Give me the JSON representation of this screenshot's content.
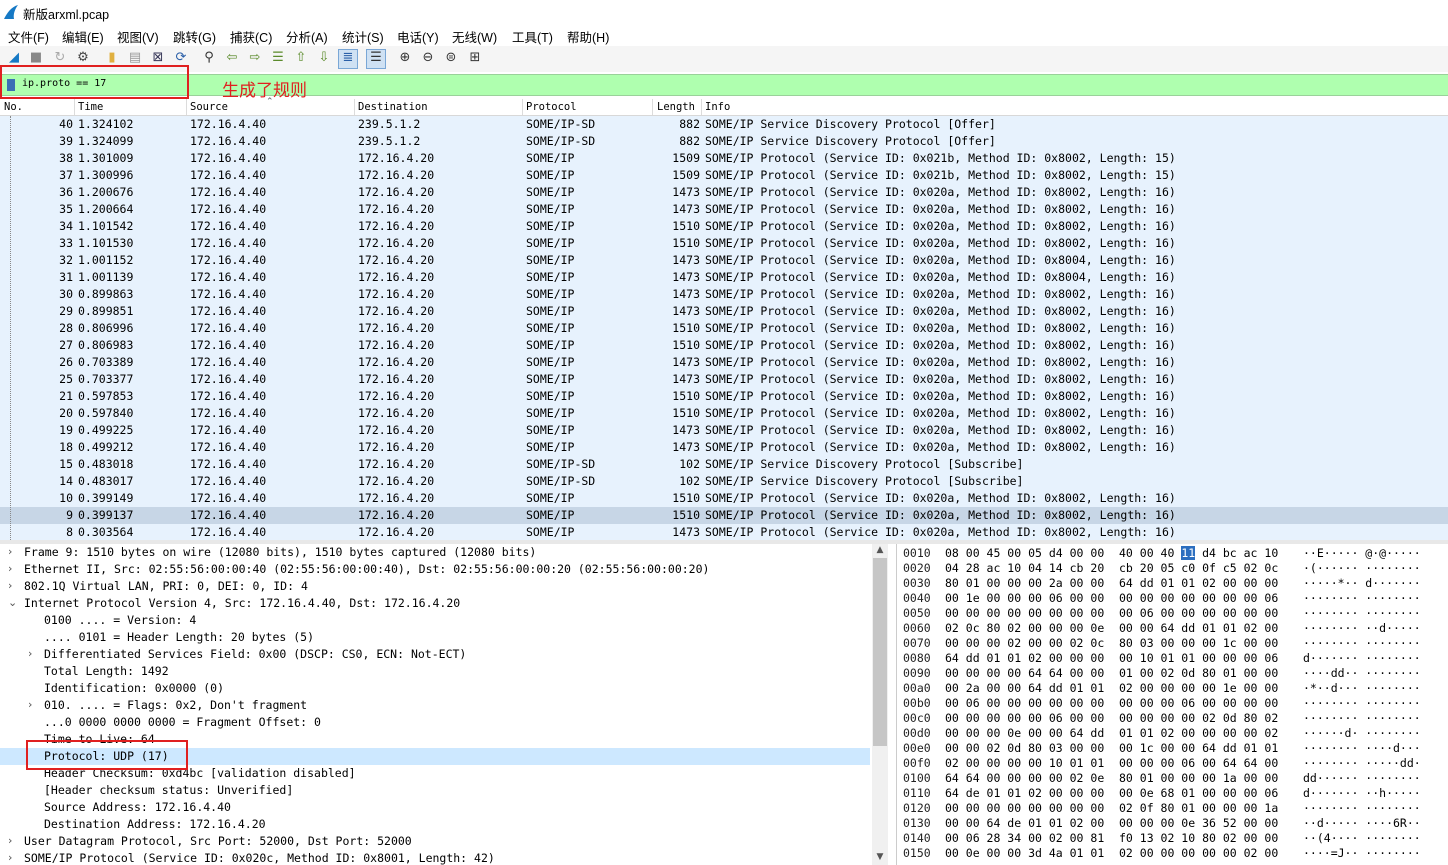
{
  "window": {
    "title": "新版arxml.pcap"
  },
  "menu": [
    "文件(F)",
    "编辑(E)",
    "视图(V)",
    "跳转(G)",
    "捕获(C)",
    "分析(A)",
    "统计(S)",
    "电话(Y)",
    "无线(W)",
    "工具(T)",
    "帮助(H)"
  ],
  "filter": {
    "value": "ip.proto == 17"
  },
  "annotation": "生成了规则",
  "columns": [
    "No.",
    "Time",
    "Source",
    "Destination",
    "Protocol",
    "Length",
    "Info"
  ],
  "packets": [
    {
      "no": "40",
      "time": "1.324102",
      "src": "172.16.4.40",
      "dst": "239.5.1.2",
      "proto": "SOME/IP-SD",
      "len": "882",
      "info": "SOME/IP Service Discovery Protocol [Offer]"
    },
    {
      "no": "39",
      "time": "1.324099",
      "src": "172.16.4.40",
      "dst": "239.5.1.2",
      "proto": "SOME/IP-SD",
      "len": "882",
      "info": "SOME/IP Service Discovery Protocol [Offer]"
    },
    {
      "no": "38",
      "time": "1.301009",
      "src": "172.16.4.40",
      "dst": "172.16.4.20",
      "proto": "SOME/IP",
      "len": "1509",
      "info": "SOME/IP Protocol (Service ID: 0x021b, Method ID: 0x8002, Length: 15)"
    },
    {
      "no": "37",
      "time": "1.300996",
      "src": "172.16.4.40",
      "dst": "172.16.4.20",
      "proto": "SOME/IP",
      "len": "1509",
      "info": "SOME/IP Protocol (Service ID: 0x021b, Method ID: 0x8002, Length: 15)"
    },
    {
      "no": "36",
      "time": "1.200676",
      "src": "172.16.4.40",
      "dst": "172.16.4.20",
      "proto": "SOME/IP",
      "len": "1473",
      "info": "SOME/IP Protocol (Service ID: 0x020a, Method ID: 0x8002, Length: 16)"
    },
    {
      "no": "35",
      "time": "1.200664",
      "src": "172.16.4.40",
      "dst": "172.16.4.20",
      "proto": "SOME/IP",
      "len": "1473",
      "info": "SOME/IP Protocol (Service ID: 0x020a, Method ID: 0x8002, Length: 16)"
    },
    {
      "no": "34",
      "time": "1.101542",
      "src": "172.16.4.40",
      "dst": "172.16.4.20",
      "proto": "SOME/IP",
      "len": "1510",
      "info": "SOME/IP Protocol (Service ID: 0x020a, Method ID: 0x8002, Length: 16)"
    },
    {
      "no": "33",
      "time": "1.101530",
      "src": "172.16.4.40",
      "dst": "172.16.4.20",
      "proto": "SOME/IP",
      "len": "1510",
      "info": "SOME/IP Protocol (Service ID: 0x020a, Method ID: 0x8002, Length: 16)"
    },
    {
      "no": "32",
      "time": "1.001152",
      "src": "172.16.4.40",
      "dst": "172.16.4.20",
      "proto": "SOME/IP",
      "len": "1473",
      "info": "SOME/IP Protocol (Service ID: 0x020a, Method ID: 0x8004, Length: 16)"
    },
    {
      "no": "31",
      "time": "1.001139",
      "src": "172.16.4.40",
      "dst": "172.16.4.20",
      "proto": "SOME/IP",
      "len": "1473",
      "info": "SOME/IP Protocol (Service ID: 0x020a, Method ID: 0x8004, Length: 16)"
    },
    {
      "no": "30",
      "time": "0.899863",
      "src": "172.16.4.40",
      "dst": "172.16.4.20",
      "proto": "SOME/IP",
      "len": "1473",
      "info": "SOME/IP Protocol (Service ID: 0x020a, Method ID: 0x8002, Length: 16)"
    },
    {
      "no": "29",
      "time": "0.899851",
      "src": "172.16.4.40",
      "dst": "172.16.4.20",
      "proto": "SOME/IP",
      "len": "1473",
      "info": "SOME/IP Protocol (Service ID: 0x020a, Method ID: 0x8002, Length: 16)"
    },
    {
      "no": "28",
      "time": "0.806996",
      "src": "172.16.4.40",
      "dst": "172.16.4.20",
      "proto": "SOME/IP",
      "len": "1510",
      "info": "SOME/IP Protocol (Service ID: 0x020a, Method ID: 0x8002, Length: 16)"
    },
    {
      "no": "27",
      "time": "0.806983",
      "src": "172.16.4.40",
      "dst": "172.16.4.20",
      "proto": "SOME/IP",
      "len": "1510",
      "info": "SOME/IP Protocol (Service ID: 0x020a, Method ID: 0x8002, Length: 16)"
    },
    {
      "no": "26",
      "time": "0.703389",
      "src": "172.16.4.40",
      "dst": "172.16.4.20",
      "proto": "SOME/IP",
      "len": "1473",
      "info": "SOME/IP Protocol (Service ID: 0x020a, Method ID: 0x8002, Length: 16)"
    },
    {
      "no": "25",
      "time": "0.703377",
      "src": "172.16.4.40",
      "dst": "172.16.4.20",
      "proto": "SOME/IP",
      "len": "1473",
      "info": "SOME/IP Protocol (Service ID: 0x020a, Method ID: 0x8002, Length: 16)"
    },
    {
      "no": "21",
      "time": "0.597853",
      "src": "172.16.4.40",
      "dst": "172.16.4.20",
      "proto": "SOME/IP",
      "len": "1510",
      "info": "SOME/IP Protocol (Service ID: 0x020a, Method ID: 0x8002, Length: 16)"
    },
    {
      "no": "20",
      "time": "0.597840",
      "src": "172.16.4.40",
      "dst": "172.16.4.20",
      "proto": "SOME/IP",
      "len": "1510",
      "info": "SOME/IP Protocol (Service ID: 0x020a, Method ID: 0x8002, Length: 16)"
    },
    {
      "no": "19",
      "time": "0.499225",
      "src": "172.16.4.40",
      "dst": "172.16.4.20",
      "proto": "SOME/IP",
      "len": "1473",
      "info": "SOME/IP Protocol (Service ID: 0x020a, Method ID: 0x8002, Length: 16)"
    },
    {
      "no": "18",
      "time": "0.499212",
      "src": "172.16.4.40",
      "dst": "172.16.4.20",
      "proto": "SOME/IP",
      "len": "1473",
      "info": "SOME/IP Protocol (Service ID: 0x020a, Method ID: 0x8002, Length: 16)"
    },
    {
      "no": "15",
      "time": "0.483018",
      "src": "172.16.4.40",
      "dst": "172.16.4.20",
      "proto": "SOME/IP-SD",
      "len": "102",
      "info": "SOME/IP Service Discovery Protocol [Subscribe]"
    },
    {
      "no": "14",
      "time": "0.483017",
      "src": "172.16.4.40",
      "dst": "172.16.4.20",
      "proto": "SOME/IP-SD",
      "len": "102",
      "info": "SOME/IP Service Discovery Protocol [Subscribe]"
    },
    {
      "no": "10",
      "time": "0.399149",
      "src": "172.16.4.40",
      "dst": "172.16.4.20",
      "proto": "SOME/IP",
      "len": "1510",
      "info": "SOME/IP Protocol (Service ID: 0x020a, Method ID: 0x8002, Length: 16)"
    },
    {
      "no": "9",
      "time": "0.399137",
      "src": "172.16.4.40",
      "dst": "172.16.4.20",
      "proto": "SOME/IP",
      "len": "1510",
      "info": "SOME/IP Protocol (Service ID: 0x020a, Method ID: 0x8002, Length: 16)",
      "selected": true
    },
    {
      "no": "8",
      "time": "0.303564",
      "src": "172.16.4.40",
      "dst": "172.16.4.20",
      "proto": "SOME/IP",
      "len": "1473",
      "info": "SOME/IP Protocol (Service ID: 0x020a, Method ID: 0x8002, Length: 16)"
    }
  ],
  "details": [
    {
      "indent": 0,
      "arrow": "›",
      "text": "Frame 9: 1510 bytes on wire (12080 bits), 1510 bytes captured (12080 bits)"
    },
    {
      "indent": 0,
      "arrow": "›",
      "text": "Ethernet II, Src: 02:55:56:00:00:40 (02:55:56:00:00:40), Dst: 02:55:56:00:00:20 (02:55:56:00:00:20)"
    },
    {
      "indent": 0,
      "arrow": "›",
      "text": "802.1Q Virtual LAN, PRI: 0, DEI: 0, ID: 4"
    },
    {
      "indent": 0,
      "arrow": "⌄",
      "text": "Internet Protocol Version 4, Src: 172.16.4.40, Dst: 172.16.4.20"
    },
    {
      "indent": 1,
      "arrow": "",
      "text": "0100 .... = Version: 4"
    },
    {
      "indent": 1,
      "arrow": "",
      "text": ".... 0101 = Header Length: 20 bytes (5)"
    },
    {
      "indent": 1,
      "arrow": "›",
      "text": "Differentiated Services Field: 0x00 (DSCP: CS0, ECN: Not-ECT)"
    },
    {
      "indent": 1,
      "arrow": "",
      "text": "Total Length: 1492"
    },
    {
      "indent": 1,
      "arrow": "",
      "text": "Identification: 0x0000 (0)"
    },
    {
      "indent": 1,
      "arrow": "›",
      "text": "010. .... = Flags: 0x2, Don't fragment"
    },
    {
      "indent": 1,
      "arrow": "",
      "text": "...0 0000 0000 0000 = Fragment Offset: 0"
    },
    {
      "indent": 1,
      "arrow": "",
      "text": "Time to Live: 64"
    },
    {
      "indent": 1,
      "arrow": "",
      "text": "Protocol: UDP (17)",
      "highlight": true
    },
    {
      "indent": 1,
      "arrow": "",
      "text": "Header Checksum: 0xd4bc [validation disabled]"
    },
    {
      "indent": 1,
      "arrow": "",
      "text": "[Header checksum status: Unverified]"
    },
    {
      "indent": 1,
      "arrow": "",
      "text": "Source Address: 172.16.4.40"
    },
    {
      "indent": 1,
      "arrow": "",
      "text": "Destination Address: 172.16.4.20"
    },
    {
      "indent": 0,
      "arrow": "›",
      "text": "User Datagram Protocol, Src Port: 52000, Dst Port: 52000"
    },
    {
      "indent": 0,
      "arrow": "›",
      "text": "SOME/IP Protocol (Service ID: 0x020c, Method ID: 0x8001, Length: 42)"
    }
  ],
  "hex": [
    {
      "off": "0010",
      "a": "08 00 45 00 05 d4 00 00",
      "b": "40 00 40 ",
      "sel": "11",
      "b2": " d4 bc ac 10",
      "asc": "··E····· @·@·····"
    },
    {
      "off": "0020",
      "a": "04 28 ac 10 04 14 cb 20",
      "b": "cb 20 05 c0 0f c5 02 0c",
      "asc": "·(······ ········"
    },
    {
      "off": "0030",
      "a": "80 01 00 00 00 2a 00 00",
      "b": "64 dd 01 01 02 00 00 00",
      "asc": "·····*·· d·······"
    },
    {
      "off": "0040",
      "a": "00 1e 00 00 00 06 00 00",
      "b": "00 00 00 00 00 00 00 06",
      "asc": "········ ········"
    },
    {
      "off": "0050",
      "a": "00 00 00 00 00 00 00 00",
      "b": "00 06 00 00 00 00 00 00",
      "asc": "········ ········"
    },
    {
      "off": "0060",
      "a": "02 0c 80 02 00 00 00 0e",
      "b": "00 00 64 dd 01 01 02 00",
      "asc": "········ ··d·····"
    },
    {
      "off": "0070",
      "a": "00 00 00 02 00 00 02 0c",
      "b": "80 03 00 00 00 1c 00 00",
      "asc": "········ ········"
    },
    {
      "off": "0080",
      "a": "64 dd 01 01 02 00 00 00",
      "b": "00 10 01 01 00 00 00 06",
      "asc": "d······· ········"
    },
    {
      "off": "0090",
      "a": "00 00 00 00 64 64 00 00",
      "b": "01 00 02 0d 80 01 00 00",
      "asc": "····dd·· ········"
    },
    {
      "off": "00a0",
      "a": "00 2a 00 00 64 dd 01 01",
      "b": "02 00 00 00 00 1e 00 00",
      "asc": "·*··d··· ········"
    },
    {
      "off": "00b0",
      "a": "00 06 00 00 00 00 00 00",
      "b": "00 00 00 06 00 00 00 00",
      "asc": "········ ········"
    },
    {
      "off": "00c0",
      "a": "00 00 00 00 00 06 00 00",
      "b": "00 00 00 00 02 0d 80 02",
      "asc": "········ ········"
    },
    {
      "off": "00d0",
      "a": "00 00 00 0e 00 00 64 dd",
      "b": "01 01 02 00 00 00 00 02",
      "asc": "······d· ········"
    },
    {
      "off": "00e0",
      "a": "00 00 02 0d 80 03 00 00",
      "b": "00 1c 00 00 64 dd 01 01",
      "asc": "········ ····d···"
    },
    {
      "off": "00f0",
      "a": "02 00 00 00 00 10 01 01",
      "b": "00 00 00 06 00 64 64 00",
      "asc": "········ ·····dd·"
    },
    {
      "off": "0100",
      "a": "64 64 00 00 00 00 02 0e",
      "b": "80 01 00 00 00 1a 00 00",
      "asc": "dd······ ········"
    },
    {
      "off": "0110",
      "a": "64 de 01 01 02 00 00 00",
      "b": "00 0e 68 01 00 00 00 06",
      "asc": "d······· ··h·····"
    },
    {
      "off": "0120",
      "a": "00 00 00 00 00 00 00 00",
      "b": "02 0f 80 01 00 00 00 1a",
      "asc": "········ ········"
    },
    {
      "off": "0130",
      "a": "00 00 64 de 01 01 02 00",
      "b": "00 00 00 0e 36 52 00 00",
      "asc": "··d····· ····6R··"
    },
    {
      "off": "0140",
      "a": "00 06 28 34 00 02 00 81",
      "b": "f0 13 02 10 80 02 00 00",
      "asc": "··(4···· ········"
    },
    {
      "off": "0150",
      "a": "00 0e 00 00 3d 4a 01 01",
      "b": "02 00 00 00 00 00 02 00",
      "asc": "····=J·· ········"
    }
  ],
  "colors": {
    "filter_ok": "#afffaf",
    "row_bg": "#e7f2fd",
    "row_selected": "#c7d6e6",
    "highlight": "#cde8ff",
    "annotation": "#e02020"
  }
}
